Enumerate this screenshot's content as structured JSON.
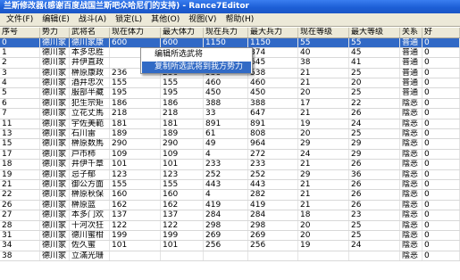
{
  "window": {
    "title": "兰斯修改器(感谢百度战国兰斯吧众哈尼们的支持) - Rance7Editor"
  },
  "menu": [
    "文件(F)",
    "编辑(E)",
    "战斗(A)",
    "锁定(L)",
    "其他(O)",
    "视图(V)",
    "帮助(H)"
  ],
  "table": {
    "columns": [
      "序号",
      "势力",
      "武将名",
      "现在体力",
      "最大体力",
      "现在兵力",
      "最大兵力",
      "现在等级",
      "最大等级",
      "关系",
      "好"
    ],
    "rows": [
      [
        "0",
        "德川家",
        "德川家康",
        "600",
        "600",
        "1150",
        "1150",
        "55",
        "55",
        "普通",
        "0"
      ],
      [
        "1",
        "德川家",
        "本多忠胜",
        "",
        "",
        "",
        "874",
        "40",
        "45",
        "普通",
        "0"
      ],
      [
        "2",
        "德川家",
        "井伊直政",
        "",
        "",
        "",
        "645",
        "38",
        "41",
        "普通",
        "0"
      ],
      [
        "3",
        "德川家",
        "榊原康政",
        "236",
        "236",
        "538",
        "538",
        "21",
        "25",
        "普通",
        "0"
      ],
      [
        "4",
        "德川家",
        "酒井忠次",
        "155",
        "155",
        "460",
        "460",
        "21",
        "20",
        "普通",
        "0"
      ],
      [
        "5",
        "德川家",
        "服部半藏",
        "195",
        "195",
        "450",
        "450",
        "20",
        "25",
        "普通",
        "0"
      ],
      [
        "6",
        "德川家",
        "犯生宗矩",
        "186",
        "186",
        "388",
        "388",
        "17",
        "22",
        "陰恶",
        "0"
      ],
      [
        "7",
        "德川家",
        "立花丈馬",
        "218",
        "218",
        "33",
        "647",
        "21",
        "26",
        "陰恶",
        "0"
      ],
      [
        "11",
        "德川家",
        "宇佐美範",
        "181",
        "181",
        "891",
        "891",
        "19",
        "24",
        "陰恶",
        "0"
      ],
      [
        "13",
        "德川家",
        "石川雷",
        "189",
        "189",
        "61",
        "808",
        "20",
        "25",
        "陰恶",
        "0"
      ],
      [
        "15",
        "德川家",
        "榊原数馬",
        "290",
        "290",
        "49",
        "964",
        "29",
        "29",
        "陰恶",
        "0"
      ],
      [
        "17",
        "德川家",
        "戸市柿",
        "109",
        "109",
        "4",
        "272",
        "24",
        "29",
        "陰恶",
        "0"
      ],
      [
        "18",
        "德川家",
        "井伊千章",
        "101",
        "101",
        "233",
        "233",
        "21",
        "26",
        "陰恶",
        "0"
      ],
      [
        "19",
        "德川家",
        "忌子郁",
        "123",
        "123",
        "252",
        "252",
        "29",
        "36",
        "陰恶",
        "0"
      ],
      [
        "21",
        "德川家",
        "御公方面",
        "155",
        "155",
        "443",
        "443",
        "21",
        "26",
        "陰恶",
        "0"
      ],
      [
        "22",
        "德川家",
        "榊原秋保",
        "160",
        "160",
        "4",
        "282",
        "21",
        "26",
        "陰恶",
        "0"
      ],
      [
        "26",
        "德川家",
        "榊原篮",
        "162",
        "162",
        "419",
        "419",
        "21",
        "26",
        "陰恶",
        "0"
      ],
      [
        "27",
        "德川家",
        "本多门欢",
        "137",
        "137",
        "284",
        "284",
        "18",
        "23",
        "陰恶",
        "0"
      ],
      [
        "28",
        "德川家",
        "十河次狂",
        "122",
        "122",
        "298",
        "298",
        "20",
        "25",
        "陰恶",
        "0"
      ],
      [
        "31",
        "德川家",
        "德川蜜柑",
        "199",
        "199",
        "269",
        "269",
        "20",
        "25",
        "陰恶",
        "0"
      ],
      [
        "34",
        "德川家",
        "佐久蜜",
        "101",
        "101",
        "256",
        "256",
        "19",
        "24",
        "陰恶",
        "0"
      ],
      [
        "38",
        "德川家",
        "立滿光珊",
        "",
        "",
        "",
        "",
        "",
        "",
        "陰恶",
        "0"
      ]
    ]
  },
  "context_menu": {
    "items": [
      "编辑所选武将",
      "复制所选武将到我方势力"
    ]
  },
  "colors": {
    "title_bar": "#1d5fd6",
    "selection": "#3169c6",
    "menu_bg": "#ece9d8"
  }
}
